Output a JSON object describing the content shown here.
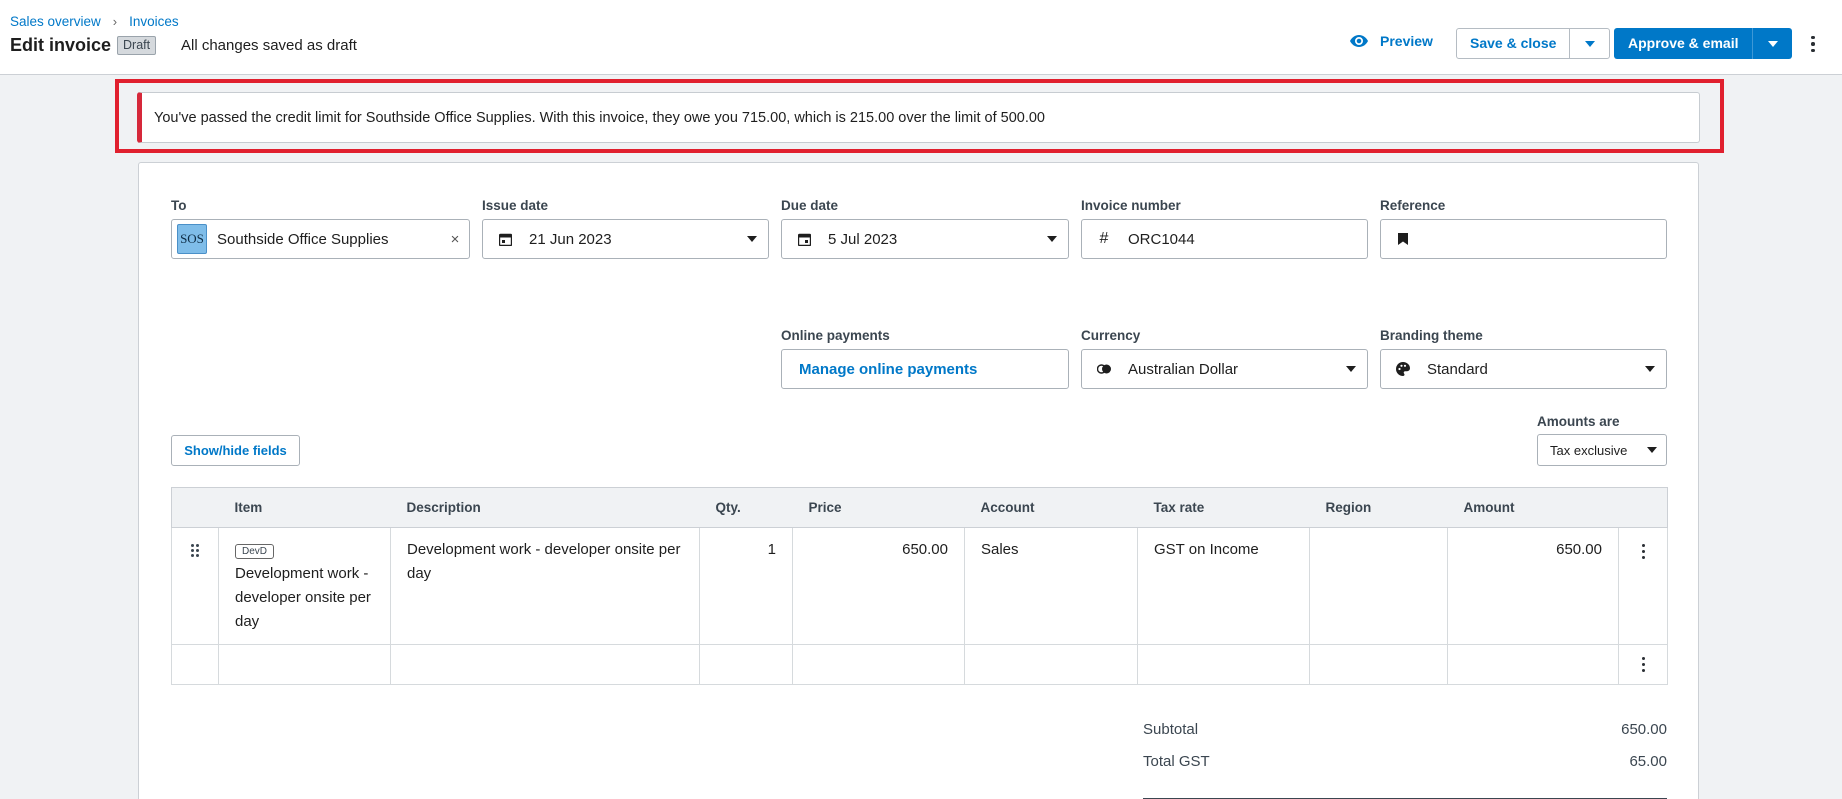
{
  "breadcrumb": {
    "items": [
      "Sales overview",
      "Invoices"
    ],
    "separator": "›"
  },
  "header": {
    "title": "Edit invoice",
    "status_badge": "Draft",
    "saved_status": "All changes saved as draft",
    "preview_label": "Preview",
    "save_close_label": "Save & close",
    "approve_email_label": "Approve & email"
  },
  "alert": {
    "message": "You've passed the credit limit for Southside Office Supplies. With this invoice, they owe you 715.00, which is 215.00 over the limit of 500.00",
    "color": "#d6283a"
  },
  "form": {
    "to": {
      "label": "To",
      "avatar": "SOS",
      "value": "Southside Office Supplies"
    },
    "issue_date": {
      "label": "Issue date",
      "value": "21 Jun 2023"
    },
    "due_date": {
      "label": "Due date",
      "value": "5 Jul 2023"
    },
    "invoice_number": {
      "label": "Invoice number",
      "value": "ORC1044"
    },
    "reference": {
      "label": "Reference",
      "value": ""
    },
    "online_payments": {
      "label": "Online payments",
      "link": "Manage online payments"
    },
    "currency": {
      "label": "Currency",
      "value": "Australian Dollar"
    },
    "branding_theme": {
      "label": "Branding theme",
      "value": "Standard"
    },
    "show_hide_label": "Show/hide fields",
    "amounts_are": {
      "label": "Amounts are",
      "value": "Tax exclusive"
    }
  },
  "table": {
    "headers": [
      "Item",
      "Description",
      "Qty.",
      "Price",
      "Account",
      "Tax rate",
      "Region",
      "Amount"
    ],
    "rows": [
      {
        "item_code": "DevD",
        "item_name": "Development work - developer onsite per day",
        "description": "Development work - developer onsite per day",
        "qty": "1",
        "price": "650.00",
        "account": "Sales",
        "tax_rate": "GST on Income",
        "region": "",
        "amount": "650.00"
      }
    ]
  },
  "totals": {
    "subtotal_label": "Subtotal",
    "subtotal_value": "650.00",
    "gst_label": "Total GST",
    "gst_value": "65.00"
  },
  "colors": {
    "accent": "#0078c8",
    "alert": "#d6283a",
    "highlight_outline": "#e0202e"
  }
}
